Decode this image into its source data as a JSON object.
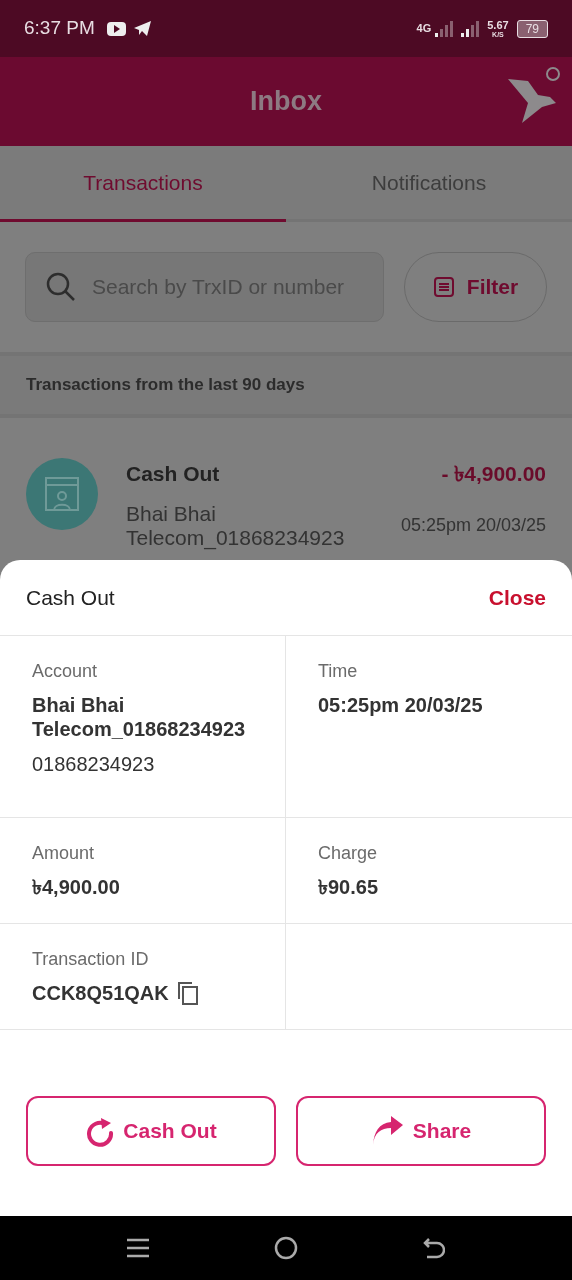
{
  "status_bar": {
    "time": "6:37 PM",
    "network": "4G",
    "speed": "5.67",
    "speed_unit": "K/S",
    "battery": "79"
  },
  "header": {
    "title": "Inbox"
  },
  "tabs": [
    {
      "label": "Transactions",
      "selected": true
    },
    {
      "label": "Notifications",
      "selected": false
    }
  ],
  "search": {
    "placeholder": "Search by TrxID or number"
  },
  "filter_button": "Filter",
  "section_label": "Transactions from the last 90 days",
  "transaction": {
    "type": "Cash Out",
    "amount": "- ৳4,900.00",
    "party": "Bhai Bhai Telecom_01868234923",
    "time": "05:25pm 20/03/25"
  },
  "sheet": {
    "title": "Cash Out",
    "close": "Close",
    "details": [
      {
        "label": "Account",
        "value": "Bhai Bhai Telecom_01868234923",
        "secondary": "01868234923",
        "copyable": false
      },
      {
        "label": "Time",
        "value": "05:25pm 20/03/25",
        "copyable": false
      },
      {
        "label": "Amount",
        "value": "৳4,900.00",
        "copyable": false
      },
      {
        "label": "Charge",
        "value": "৳90.65",
        "copyable": false
      },
      {
        "label": "Transaction ID",
        "value": "CCK8Q51QAK",
        "copyable": true
      }
    ],
    "actions": [
      {
        "kind": "repeat",
        "label": "Cash Out"
      },
      {
        "kind": "share",
        "label": "Share"
      }
    ]
  }
}
